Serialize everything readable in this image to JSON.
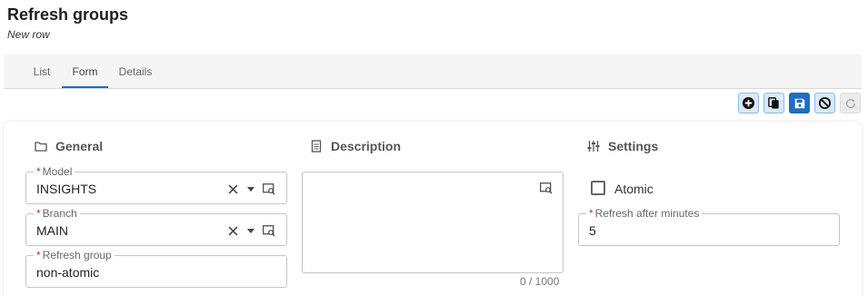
{
  "page": {
    "title": "Refresh groups",
    "subtitle": "New row"
  },
  "tabs": [
    {
      "label": "List",
      "active": false
    },
    {
      "label": "Form",
      "active": true
    },
    {
      "label": "Details",
      "active": false
    }
  ],
  "toolbar": {
    "buttons": [
      {
        "icon": "add-circle-icon"
      },
      {
        "icon": "copy-icon"
      },
      {
        "icon": "save-icon"
      },
      {
        "icon": "cancel-icon"
      },
      {
        "icon": "refresh-icon"
      }
    ]
  },
  "sections": {
    "general": {
      "title": "General",
      "icon": "folder-icon"
    },
    "description": {
      "title": "Description",
      "icon": "document-icon"
    },
    "settings": {
      "title": "Settings",
      "icon": "sliders-icon"
    }
  },
  "general": {
    "model": {
      "label": "Model",
      "required_mark": "*",
      "value": "INSIGHTS"
    },
    "branch": {
      "label": "Branch",
      "required_mark": "*",
      "value": "MAIN"
    },
    "refresh_group": {
      "label": "Refresh group",
      "required_mark": "*",
      "value": "non-atomic"
    }
  },
  "description": {
    "value": "",
    "counter": "0 / 1000"
  },
  "settings": {
    "atomic": {
      "label": "Atomic",
      "checked": false
    },
    "refresh_after": {
      "label": "Refresh after minutes",
      "required_mark": "*",
      "value": "5"
    }
  },
  "colors": {
    "accent": "#1e6fc2",
    "required": "#d32f2f",
    "tab_bar_bg": "#f5f5f5"
  }
}
